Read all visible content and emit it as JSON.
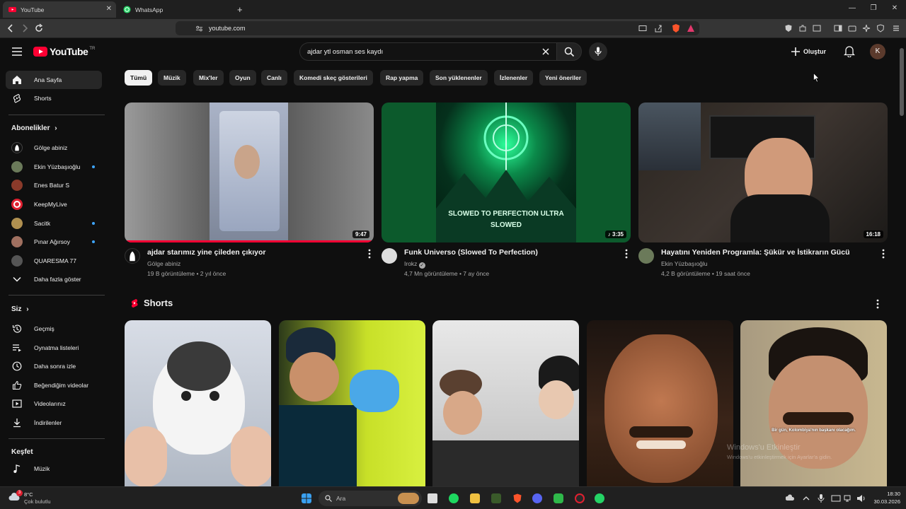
{
  "browser": {
    "tabs": [
      {
        "label": "YouTube",
        "active": true
      },
      {
        "label": "WhatsApp",
        "active": false
      }
    ],
    "new_tab": "+",
    "url": "youtube.com"
  },
  "header": {
    "logo_text": "YouTube",
    "logo_country": "TR",
    "search_value": "ajdar ytl osman ses kaydı",
    "create_label": "Oluştur",
    "avatar_letter": "K"
  },
  "sidebar": {
    "main": [
      {
        "label": "Ana Sayfa",
        "icon": "home-icon",
        "active": true
      },
      {
        "label": "Shorts",
        "icon": "shorts-icon",
        "active": false
      }
    ],
    "subs_heading": "Abonelikler",
    "subs": [
      {
        "label": "Gölge abiniz",
        "color": "#2a2a2a",
        "new": false
      },
      {
        "label": "Ekin Yüzbaşıoğlu",
        "color": "#6b7a5a",
        "new": true
      },
      {
        "label": "Enes Batur S",
        "color": "#8a3a2a",
        "new": false
      },
      {
        "label": "KeepMyLive",
        "color": "#e02030",
        "new": false
      },
      {
        "label": "Sacitk",
        "color": "#b09050",
        "new": true
      },
      {
        "label": "Pınar Ağırsoy",
        "color": "#a07060",
        "new": true
      },
      {
        "label": "QUARESMA 77",
        "color": "#555555",
        "new": false
      }
    ],
    "show_more": "Daha fazla göster",
    "you_heading": "Siz",
    "you": [
      {
        "label": "Geçmiş",
        "icon": "history-icon"
      },
      {
        "label": "Oynatma listeleri",
        "icon": "playlist-icon"
      },
      {
        "label": "Daha sonra izle",
        "icon": "clock-icon"
      },
      {
        "label": "Beğendiğim videolar",
        "icon": "like-icon"
      },
      {
        "label": "Videolarınız",
        "icon": "video-icon"
      },
      {
        "label": "İndirilenler",
        "icon": "download-icon"
      }
    ],
    "explore_heading": "Keşfet",
    "explore": [
      {
        "label": "Müzik",
        "icon": "music-icon"
      }
    ]
  },
  "chips": [
    "Tümü",
    "Müzik",
    "Mix'ler",
    "Oyun",
    "Canlı",
    "Komedi skeç gösterileri",
    "Rap yapma",
    "Son yüklenenler",
    "İzlenenler",
    "Yeni öneriler"
  ],
  "videos": [
    {
      "title": "ajdar starımız yine çileden çıkıyor",
      "channel": "Gölge abiniz",
      "verified": false,
      "meta": "19 B görüntüleme • 2 yıl önce",
      "duration": "9:47",
      "progress": 1.0,
      "thumb_text": ""
    },
    {
      "title": "Funk Universo (Slowed To Perfection)",
      "channel": "Irokz",
      "verified": true,
      "meta": "4,7 Mn görüntüleme • 7 ay önce",
      "duration": "♪ 3:35",
      "progress": 0,
      "thumb_text": "SLOWED TO PERFECTION ULTRA SLOWED"
    },
    {
      "title": "Hayatını Yeniden Programla: Şükür ve İstikrarın Gücü",
      "channel": "Ekin Yüzbaşıoğlu",
      "verified": false,
      "meta": "4,2 B görüntüleme • 19 saat önce",
      "duration": "16:18",
      "progress": 0,
      "thumb_text": ""
    }
  ],
  "shorts": {
    "heading": "Shorts",
    "subtitle_text": "Bir gün, Kolombiya'nın başkanı olacağım."
  },
  "watermark": {
    "line1": "Windows'u Etkinleştir",
    "line2": "Windows'u etkinleştirmek için Ayarlar'a gidin."
  },
  "taskbar": {
    "weather_temp": "8°C",
    "weather_desc": "Çok bulutlu",
    "weather_badge": "3",
    "search_placeholder": "Ara",
    "time": "18:30",
    "date": "30.03.2026"
  }
}
